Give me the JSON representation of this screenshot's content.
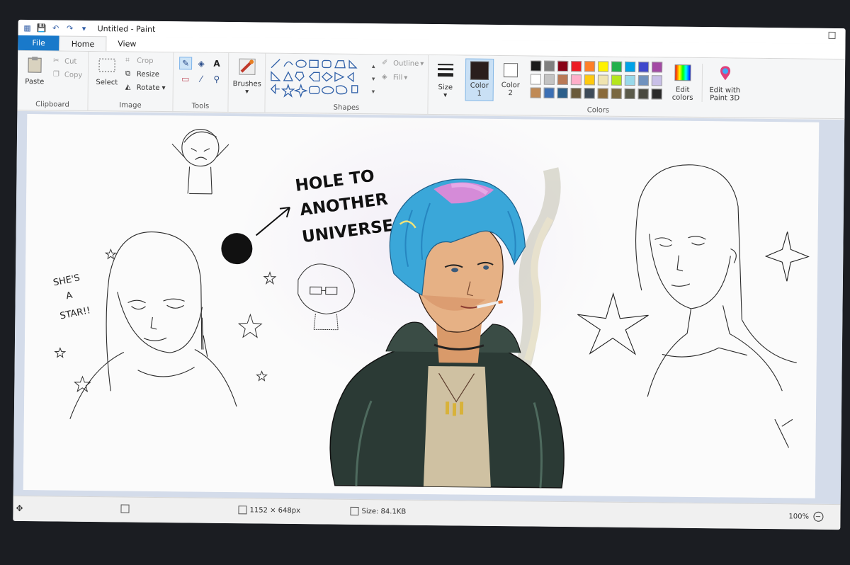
{
  "window": {
    "title": "Untitled - Paint"
  },
  "tabs": [
    {
      "label": "File"
    },
    {
      "label": "Home"
    },
    {
      "label": "View"
    }
  ],
  "ribbon": {
    "clipboard": {
      "label": "Clipboard",
      "paste": "Paste",
      "cut": "Cut",
      "copy": "Copy"
    },
    "image": {
      "label": "Image",
      "select": "Select",
      "crop": "Crop",
      "resize": "Resize",
      "rotate": "Rotate"
    },
    "tools": {
      "label": "Tools"
    },
    "brushes": {
      "label": "Brushes"
    },
    "shapes": {
      "label": "Shapes",
      "outline": "Outline",
      "fill": "Fill"
    },
    "size": {
      "label": "Size"
    },
    "color1": {
      "label": "Color",
      "num": "1",
      "color": "#2a1e1c"
    },
    "color2": {
      "label": "Color",
      "num": "2",
      "color": "#ffffff"
    },
    "colors": {
      "label": "Colors",
      "row1": [
        "#1a1a1a",
        "#7f7f7f",
        "#880015",
        "#ed1c24",
        "#ff7f27",
        "#fff200",
        "#22b14c",
        "#00a2e8",
        "#3f48cc",
        "#a349a4"
      ],
      "row2": [
        "#ffffff",
        "#c3c3c3",
        "#b97a57",
        "#ffaec9",
        "#ffc90e",
        "#efe4b0",
        "#b5e61d",
        "#99d9ea",
        "#7092be",
        "#c8bfe7"
      ],
      "row3": [
        "#c08a55",
        "#3b6fb4",
        "#2c5f8a",
        "#6a5a3a",
        "#3d4a58",
        "#8b6b3a",
        "#7a6840",
        "#5a5a4a",
        "#4a4a40",
        "#2a2a2a"
      ]
    },
    "edit_colors": {
      "line1": "Edit",
      "line2": "colors"
    },
    "paint3d": {
      "line1": "Edit with",
      "line2": "Paint 3D"
    }
  },
  "canvas": {
    "annotation_hole": [
      "HOLE TO",
      "ANOTHER",
      "UNIVERSE"
    ],
    "annotation_star": [
      "SHE'S",
      "A",
      "STAR!!"
    ]
  },
  "status": {
    "dimensions": "1152 × 648px",
    "size": "Size: 84.1KB",
    "zoom": "100%"
  }
}
